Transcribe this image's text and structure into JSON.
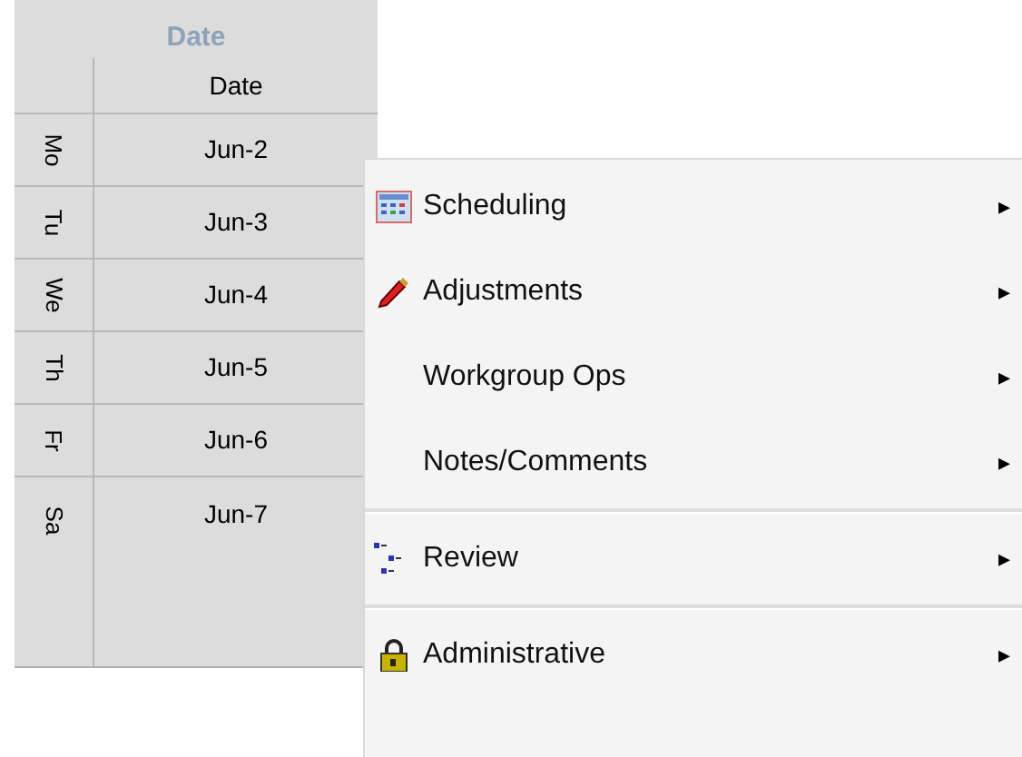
{
  "grid": {
    "title": "Date",
    "column_header": "Date",
    "rows": [
      {
        "day": "Mo",
        "date": "Jun-2"
      },
      {
        "day": "Tu",
        "date": "Jun-3"
      },
      {
        "day": "We",
        "date": "Jun-4"
      },
      {
        "day": "Th",
        "date": "Jun-5"
      },
      {
        "day": "Fr",
        "date": "Jun-6"
      },
      {
        "day": "Sa",
        "date": "Jun-7"
      }
    ]
  },
  "context_menu": {
    "items": [
      {
        "kind": "item",
        "label": "Scheduling",
        "submenu": "▸"
      },
      {
        "kind": "item",
        "label": "Adjustments",
        "submenu": "▸"
      },
      {
        "kind": "item",
        "label": "Workgroup Ops",
        "submenu": "▸"
      },
      {
        "kind": "item",
        "label": "Notes/Comments",
        "submenu": "▸"
      },
      {
        "kind": "separator"
      },
      {
        "kind": "item",
        "label": "Review",
        "submenu": "▸"
      },
      {
        "kind": "separator"
      },
      {
        "kind": "item",
        "label": "Administrative",
        "submenu": "▸"
      }
    ]
  }
}
